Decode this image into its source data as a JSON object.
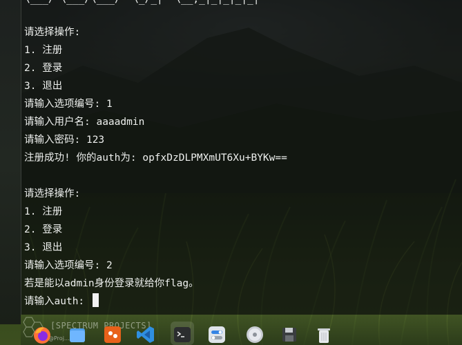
{
  "terminal": {
    "lines": [
      {
        "text": "\\___/ \\___/\\___/  \\_/_|  \\__,_|_|_|_|_|"
      },
      {
        "text": ""
      },
      {
        "text": "请选择操作:"
      },
      {
        "text": "1. 注册"
      },
      {
        "text": "2. 登录"
      },
      {
        "text": "3. 退出"
      },
      {
        "text": "请输入选项编号: 1"
      },
      {
        "text": "请输入用户名: aaaadmin"
      },
      {
        "text": "请输入密码: 123"
      },
      {
        "text": "注册成功! 你的auth为: opfxDzDLPMXmUT6Xu+BYKw=="
      },
      {
        "text": ""
      },
      {
        "text": "请选择操作:"
      },
      {
        "text": "1. 注册"
      },
      {
        "text": "2. 登录"
      },
      {
        "text": "3. 退出"
      },
      {
        "text": "请输入选项编号: 2"
      },
      {
        "text": "若是能以admin身份登录就给你flag。"
      },
      {
        "text": "请输入auth: "
      }
    ]
  },
  "dock": {
    "label": "[SPECTRUM PROJECTS]",
    "sublabel": "@Proj...st21l",
    "apps": [
      {
        "name": "firefox-icon"
      },
      {
        "name": "file-manager-icon"
      },
      {
        "name": "burp-suite-icon"
      },
      {
        "name": "vscode-icon"
      },
      {
        "name": "terminal-icon"
      },
      {
        "name": "settings-toggle-icon"
      },
      {
        "name": "disc-icon"
      },
      {
        "name": "save-disk-icon"
      },
      {
        "name": "trash-icon"
      }
    ]
  },
  "colors": {
    "terminal_text": "#eef0ee",
    "terminal_bg": "#0e100e",
    "firefox_orange": "#ff7139",
    "vscode_blue": "#2f8fe0",
    "burp_orange": "#e8611a"
  }
}
